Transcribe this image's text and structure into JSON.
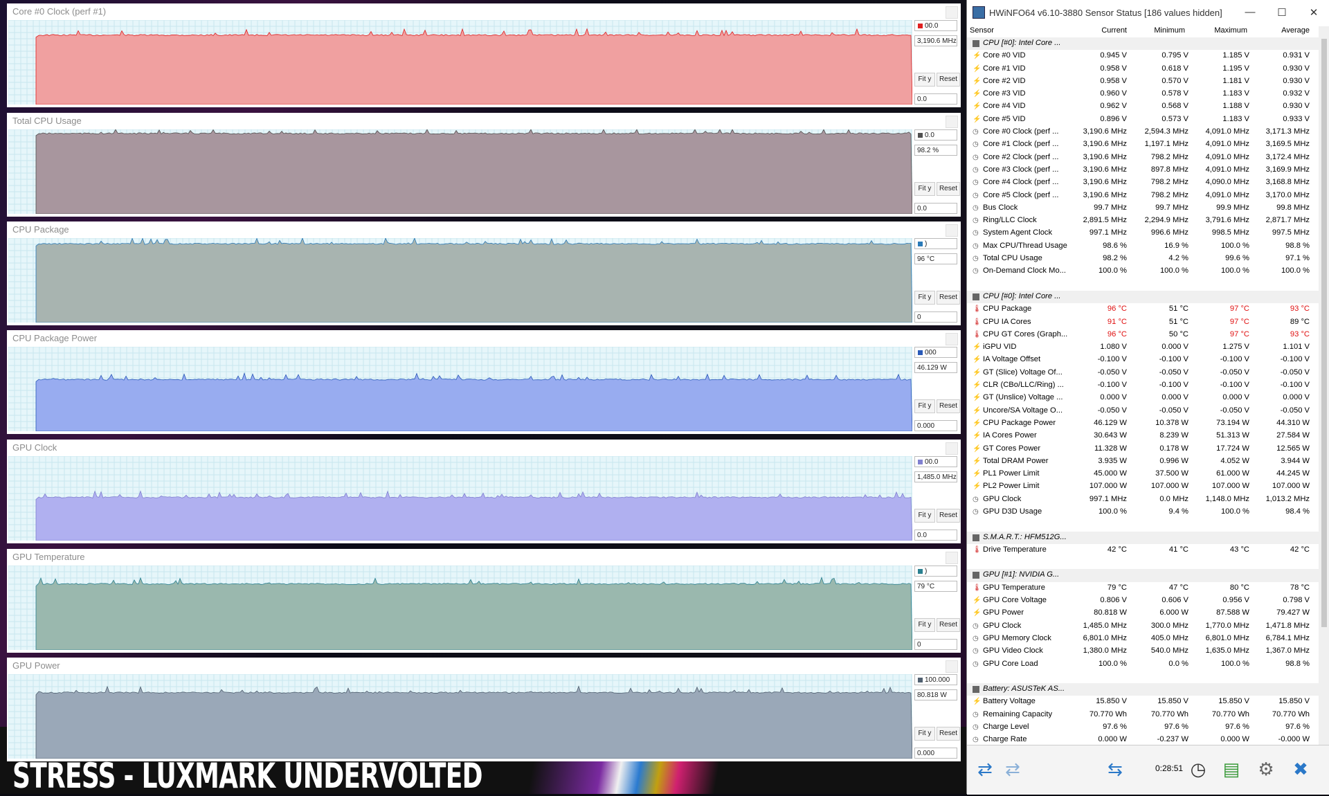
{
  "overlay_text": "STRESS - LUXMARK UNDERVOLTED",
  "panels": [
    {
      "title": "Core #0 Clock (perf #1)",
      "max": "00.0",
      "current": "3,190.6 MHz",
      "min": "0.0",
      "color": "#f0a0a0",
      "marker": "#e02020",
      "fill_level": 0.83
    },
    {
      "title": "Total CPU Usage",
      "max": "0.0",
      "current": "98.2 %",
      "min": "0.0",
      "color": "#a8969e",
      "marker": "#505050",
      "fill_level": 0.96
    },
    {
      "title": "CPU Package",
      "max": ")",
      "current": "96 °C",
      "min": "0",
      "color": "#a8b4b0",
      "marker": "#2a7ab8",
      "fill_level": 0.94
    },
    {
      "title": "CPU Package Power",
      "max": "000",
      "current": "46.129 W",
      "min": "0.000",
      "color": "#98acf0",
      "marker": "#2a5ab8",
      "fill_level": 0.62
    },
    {
      "title": "GPU Clock",
      "max": "00.0",
      "current": "1,485.0 MHz",
      "min": "0.0",
      "color": "#b0b0f0",
      "marker": "#8080d0",
      "fill_level": 0.52
    },
    {
      "title": "GPU Temperature",
      "max": ")",
      "current": "79 °C",
      "min": "0",
      "color": "#9ab8ae",
      "marker": "#2a8090",
      "fill_level": 0.79
    },
    {
      "title": "GPU Power",
      "max": "100.000",
      "current": "80.818 W",
      "min": "0.000",
      "color": "#9aa8b8",
      "marker": "#506070",
      "fill_level": 0.79
    }
  ],
  "buttons": {
    "fit_y": "Fit y",
    "reset": "Reset"
  },
  "hwinfo": {
    "title": "HWiNFO64 v6.10-3880 Sensor Status [186 values hidden]",
    "columns": {
      "sensor": "Sensor",
      "current": "Current",
      "minimum": "Minimum",
      "maximum": "Maximum",
      "average": "Average"
    },
    "elapsed": "0:28:51",
    "rows": [
      {
        "g": 1,
        "name": "CPU [#0]: Intel Core ..."
      },
      {
        "i": "volt",
        "name": "Core #0 VID",
        "c": "0.945 V",
        "mn": "0.795 V",
        "mx": "1.185 V",
        "av": "0.931 V"
      },
      {
        "i": "volt",
        "name": "Core #1 VID",
        "c": "0.958 V",
        "mn": "0.618 V",
        "mx": "1.195 V",
        "av": "0.930 V"
      },
      {
        "i": "volt",
        "name": "Core #2 VID",
        "c": "0.958 V",
        "mn": "0.570 V",
        "mx": "1.181 V",
        "av": "0.930 V"
      },
      {
        "i": "volt",
        "name": "Core #3 VID",
        "c": "0.960 V",
        "mn": "0.578 V",
        "mx": "1.183 V",
        "av": "0.932 V"
      },
      {
        "i": "volt",
        "name": "Core #4 VID",
        "c": "0.962 V",
        "mn": "0.568 V",
        "mx": "1.188 V",
        "av": "0.930 V"
      },
      {
        "i": "volt",
        "name": "Core #5 VID",
        "c": "0.896 V",
        "mn": "0.573 V",
        "mx": "1.183 V",
        "av": "0.933 V"
      },
      {
        "i": "clock",
        "name": "Core #0 Clock (perf ...",
        "c": "3,190.6 MHz",
        "mn": "2,594.3 MHz",
        "mx": "4,091.0 MHz",
        "av": "3,171.3 MHz"
      },
      {
        "i": "clock",
        "name": "Core #1 Clock (perf ...",
        "c": "3,190.6 MHz",
        "mn": "1,197.1 MHz",
        "mx": "4,091.0 MHz",
        "av": "3,169.5 MHz"
      },
      {
        "i": "clock",
        "name": "Core #2 Clock (perf ...",
        "c": "3,190.6 MHz",
        "mn": "798.2 MHz",
        "mx": "4,091.0 MHz",
        "av": "3,172.4 MHz"
      },
      {
        "i": "clock",
        "name": "Core #3 Clock (perf ...",
        "c": "3,190.6 MHz",
        "mn": "897.8 MHz",
        "mx": "4,091.0 MHz",
        "av": "3,169.9 MHz"
      },
      {
        "i": "clock",
        "name": "Core #4 Clock (perf ...",
        "c": "3,190.6 MHz",
        "mn": "798.2 MHz",
        "mx": "4,090.0 MHz",
        "av": "3,168.8 MHz"
      },
      {
        "i": "clock",
        "name": "Core #5 Clock (perf ...",
        "c": "3,190.6 MHz",
        "mn": "798.2 MHz",
        "mx": "4,091.0 MHz",
        "av": "3,170.0 MHz"
      },
      {
        "i": "clock",
        "name": "Bus Clock",
        "c": "99.7 MHz",
        "mn": "99.7 MHz",
        "mx": "99.9 MHz",
        "av": "99.8 MHz"
      },
      {
        "i": "clock",
        "name": "Ring/LLC Clock",
        "c": "2,891.5 MHz",
        "mn": "2,294.9 MHz",
        "mx": "3,791.6 MHz",
        "av": "2,871.7 MHz"
      },
      {
        "i": "clock",
        "name": "System Agent Clock",
        "c": "997.1 MHz",
        "mn": "996.6 MHz",
        "mx": "998.5 MHz",
        "av": "997.5 MHz"
      },
      {
        "i": "clock",
        "name": "Max CPU/Thread Usage",
        "c": "98.6 %",
        "mn": "16.9 %",
        "mx": "100.0 %",
        "av": "98.8 %"
      },
      {
        "i": "clock",
        "name": "Total CPU Usage",
        "c": "98.2 %",
        "mn": "4.2 %",
        "mx": "99.6 %",
        "av": "97.1 %"
      },
      {
        "i": "clock",
        "name": "On-Demand Clock Mo...",
        "c": "100.0 %",
        "mn": "100.0 %",
        "mx": "100.0 %",
        "av": "100.0 %"
      },
      {
        "blank": 1
      },
      {
        "g": 1,
        "name": "CPU [#0]: Intel Core ..."
      },
      {
        "i": "temp",
        "name": "CPU Package",
        "c": "96 °C",
        "mn": "51 °C",
        "mx": "97 °C",
        "av": "93 °C",
        "red": [
          "c",
          "mx",
          "av"
        ]
      },
      {
        "i": "temp",
        "name": "CPU IA Cores",
        "c": "91 °C",
        "mn": "51 °C",
        "mx": "97 °C",
        "av": "89 °C",
        "red": [
          "c",
          "mx"
        ]
      },
      {
        "i": "temp",
        "name": "CPU GT Cores (Graph...",
        "c": "96 °C",
        "mn": "50 °C",
        "mx": "97 °C",
        "av": "93 °C",
        "red": [
          "c",
          "mx",
          "av"
        ]
      },
      {
        "i": "volt",
        "name": "iGPU VID",
        "c": "1.080 V",
        "mn": "0.000 V",
        "mx": "1.275 V",
        "av": "1.101 V"
      },
      {
        "i": "volt",
        "name": "IA Voltage Offset",
        "c": "-0.100 V",
        "mn": "-0.100 V",
        "mx": "-0.100 V",
        "av": "-0.100 V"
      },
      {
        "i": "volt",
        "name": "GT (Slice) Voltage Of...",
        "c": "-0.050 V",
        "mn": "-0.050 V",
        "mx": "-0.050 V",
        "av": "-0.050 V"
      },
      {
        "i": "volt",
        "name": "CLR (CBo/LLC/Ring) ...",
        "c": "-0.100 V",
        "mn": "-0.100 V",
        "mx": "-0.100 V",
        "av": "-0.100 V"
      },
      {
        "i": "volt",
        "name": "GT (Unslice) Voltage ...",
        "c": "0.000 V",
        "mn": "0.000 V",
        "mx": "0.000 V",
        "av": "0.000 V"
      },
      {
        "i": "volt",
        "name": "Uncore/SA Voltage O...",
        "c": "-0.050 V",
        "mn": "-0.050 V",
        "mx": "-0.050 V",
        "av": "-0.050 V"
      },
      {
        "i": "volt",
        "name": "CPU Package Power",
        "c": "46.129 W",
        "mn": "10.378 W",
        "mx": "73.194 W",
        "av": "44.310 W"
      },
      {
        "i": "volt",
        "name": "IA Cores Power",
        "c": "30.643 W",
        "mn": "8.239 W",
        "mx": "51.313 W",
        "av": "27.584 W"
      },
      {
        "i": "volt",
        "name": "GT Cores Power",
        "c": "11.328 W",
        "mn": "0.178 W",
        "mx": "17.724 W",
        "av": "12.565 W"
      },
      {
        "i": "volt",
        "name": "Total DRAM Power",
        "c": "3.935 W",
        "mn": "0.996 W",
        "mx": "4.052 W",
        "av": "3.944 W"
      },
      {
        "i": "volt",
        "name": "PL1 Power Limit",
        "c": "45.000 W",
        "mn": "37.500 W",
        "mx": "61.000 W",
        "av": "44.245 W"
      },
      {
        "i": "volt",
        "name": "PL2 Power Limit",
        "c": "107.000 W",
        "mn": "107.000 W",
        "mx": "107.000 W",
        "av": "107.000 W"
      },
      {
        "i": "clock",
        "name": "GPU Clock",
        "c": "997.1 MHz",
        "mn": "0.0 MHz",
        "mx": "1,148.0 MHz",
        "av": "1,013.2 MHz"
      },
      {
        "i": "clock",
        "name": "GPU D3D Usage",
        "c": "100.0 %",
        "mn": "9.4 %",
        "mx": "100.0 %",
        "av": "98.4 %"
      },
      {
        "blank": 1
      },
      {
        "g": 1,
        "name": "S.M.A.R.T.: HFM512G..."
      },
      {
        "i": "temp",
        "name": "Drive Temperature",
        "c": "42 °C",
        "mn": "41 °C",
        "mx": "43 °C",
        "av": "42 °C"
      },
      {
        "blank": 1
      },
      {
        "g": 1,
        "name": "GPU [#1]: NVIDIA G..."
      },
      {
        "i": "temp",
        "name": "GPU Temperature",
        "c": "79 °C",
        "mn": "47 °C",
        "mx": "80 °C",
        "av": "78 °C"
      },
      {
        "i": "volt",
        "name": "GPU Core Voltage",
        "c": "0.806 V",
        "mn": "0.606 V",
        "mx": "0.956 V",
        "av": "0.798 V"
      },
      {
        "i": "volt",
        "name": "GPU Power",
        "c": "80.818 W",
        "mn": "6.000 W",
        "mx": "87.588 W",
        "av": "79.427 W"
      },
      {
        "i": "clock",
        "name": "GPU Clock",
        "c": "1,485.0 MHz",
        "mn": "300.0 MHz",
        "mx": "1,770.0 MHz",
        "av": "1,471.8 MHz"
      },
      {
        "i": "clock",
        "name": "GPU Memory Clock",
        "c": "6,801.0 MHz",
        "mn": "405.0 MHz",
        "mx": "6,801.0 MHz",
        "av": "6,784.1 MHz"
      },
      {
        "i": "clock",
        "name": "GPU Video Clock",
        "c": "1,380.0 MHz",
        "mn": "540.0 MHz",
        "mx": "1,635.0 MHz",
        "av": "1,367.0 MHz"
      },
      {
        "i": "clock",
        "name": "GPU Core Load",
        "c": "100.0 %",
        "mn": "0.0 %",
        "mx": "100.0 %",
        "av": "98.8 %"
      },
      {
        "blank": 1
      },
      {
        "g": 1,
        "name": "Battery: ASUSTeK AS..."
      },
      {
        "i": "volt",
        "name": "Battery Voltage",
        "c": "15.850 V",
        "mn": "15.850 V",
        "mx": "15.850 V",
        "av": "15.850 V"
      },
      {
        "i": "clock",
        "name": "Remaining Capacity",
        "c": "70.770 Wh",
        "mn": "70.770 Wh",
        "mx": "70.770 Wh",
        "av": "70.770 Wh"
      },
      {
        "i": "clock",
        "name": "Charge Level",
        "c": "97.6 %",
        "mn": "97.6 %",
        "mx": "97.6 %",
        "av": "97.6 %"
      },
      {
        "i": "clock",
        "name": "Charge Rate",
        "c": "0.000 W",
        "mn": "-0.237 W",
        "mx": "0.000 W",
        "av": "-0.000 W"
      }
    ]
  }
}
